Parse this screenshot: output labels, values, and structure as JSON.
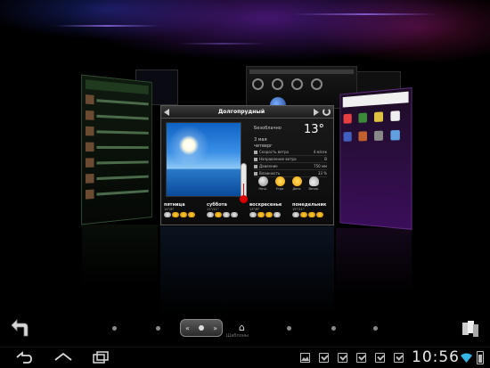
{
  "weather": {
    "city": "Долгопрудный",
    "condition": "Безоблачно",
    "temperature": "13°",
    "date_line1": "3 мая",
    "date_line2": "четверг",
    "details": [
      {
        "label": "Скорость ветра",
        "value": "4 м/сек"
      },
      {
        "label": "Направление ветра",
        "value": "В"
      },
      {
        "label": "Давление",
        "value": "750 мм"
      },
      {
        "label": "Влажность",
        "value": "33 %"
      }
    ],
    "timeslots": [
      {
        "label": "Ночь",
        "icon": "moon"
      },
      {
        "label": "Утро",
        "icon": "sun"
      },
      {
        "label": "День",
        "icon": "sun"
      },
      {
        "label": "Вечер",
        "icon": "cloud"
      }
    ],
    "forecast": [
      {
        "day": "пятница",
        "temps": "14°/8°"
      },
      {
        "day": "суббота",
        "temps": "11°/11°"
      },
      {
        "day": "воскресенье",
        "temps": "13°/6°"
      },
      {
        "day": "понедельник",
        "temps": "19°/11°"
      }
    ]
  },
  "dock": {
    "home_label": "Шаблоны",
    "page_switch": {
      "prev": "«",
      "next": "»"
    }
  },
  "statusbar": {
    "time": "10:56",
    "battery_level": 0.7
  },
  "colors": {
    "accent_purple": "#6a2a8a",
    "sky_blue": "#3a8fe6",
    "sun_orange": "#f29a00"
  }
}
